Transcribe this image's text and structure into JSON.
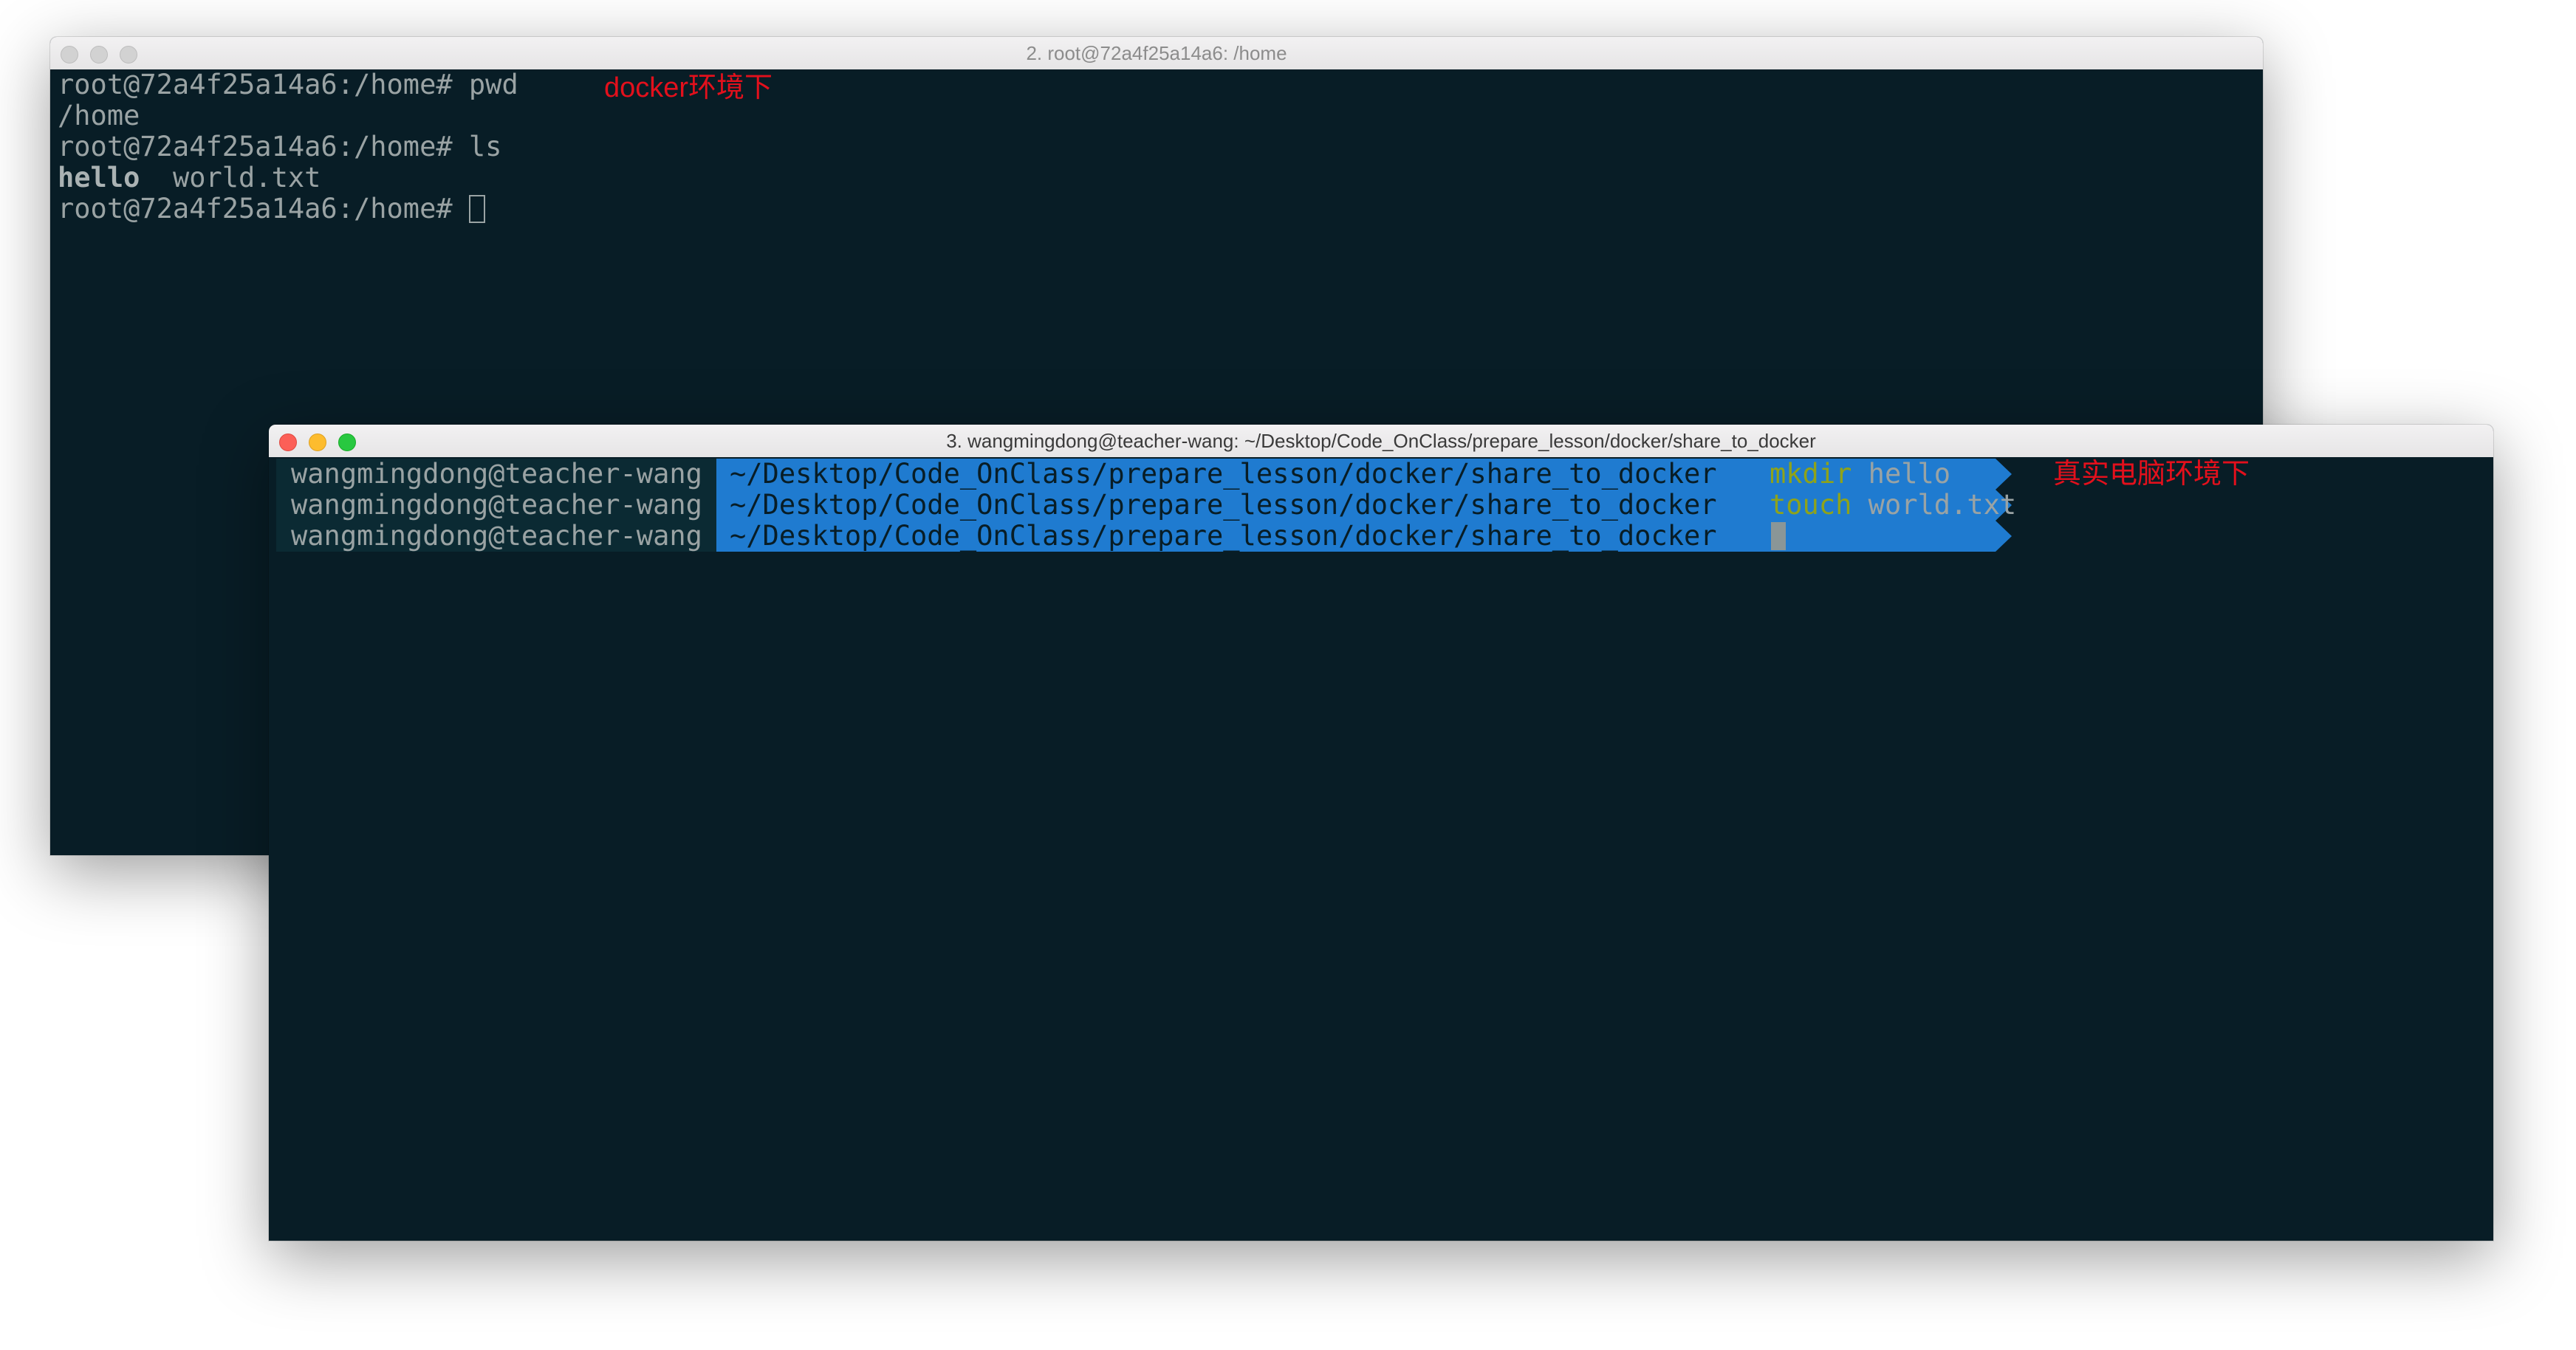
{
  "docker_window": {
    "title": "2. root@72a4f25a14a6: /home",
    "prompt": "root@72a4f25a14a6:/home#",
    "lines": [
      {
        "command": "pwd"
      },
      {
        "output": "/home"
      },
      {
        "command": "ls"
      },
      {
        "output_bold": "hello",
        "output_rest": "world.txt"
      },
      {
        "command": ""
      }
    ],
    "annotation": "docker环境下"
  },
  "host_window": {
    "title": "3. wangmingdong@teacher-wang: ~/Desktop/Code_OnClass/prepare_lesson/docker/share_to_docker",
    "user": "wangmingdong@teacher-wang",
    "path": "~/Desktop/Code_OnClass/prepare_lesson/docker/share_to_docker",
    "lines": [
      {
        "cmd": "mkdir",
        "arg": "hello"
      },
      {
        "cmd": "touch",
        "arg": "world.txt"
      },
      {
        "cmd": "",
        "arg": ""
      }
    ],
    "annotation": "真实电脑环境下"
  },
  "colors": {
    "terminal_bg": "#081d26",
    "text": "#9aa3a4",
    "path_segment": "#1f7bd0",
    "user_segment": "#0b2a33",
    "command": "#8fa31a",
    "annotation": "#e3101c",
    "close": "#fc5f57",
    "minimize": "#fdbc2e",
    "zoom": "#28c840"
  },
  "icons": {
    "close": "circle",
    "minimize": "circle",
    "zoom": "circle"
  }
}
